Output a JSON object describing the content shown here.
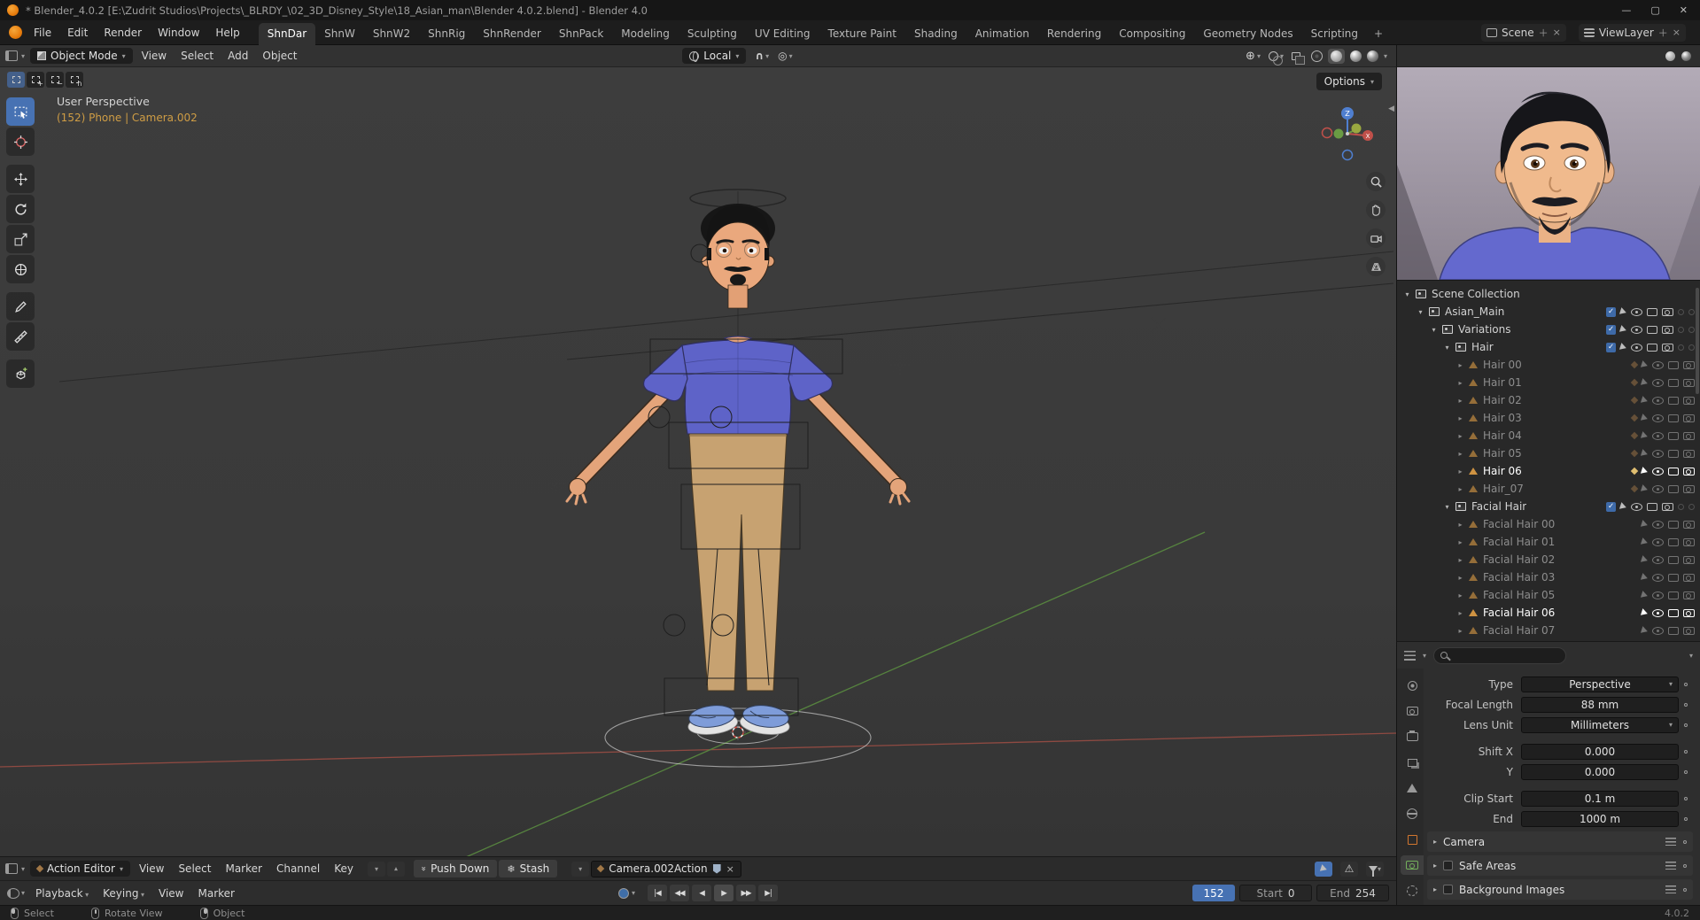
{
  "window": {
    "title": "* Blender_4.0.2 [E:\\Zudrit Studios\\Projects\\_BLRDY_\\02_3D_Disney_Style\\18_Asian_man\\Blender 4.0.2.blend] - Blender 4.0"
  },
  "topbar": {
    "menus": [
      "File",
      "Edit",
      "Render",
      "Window",
      "Help"
    ],
    "workspaces": [
      "ShnDar",
      "ShnW",
      "ShnW2",
      "ShnRig",
      "ShnRender",
      "ShnPack",
      "Modeling",
      "Sculpting",
      "UV Editing",
      "Texture Paint",
      "Shading",
      "Animation",
      "Rendering",
      "Compositing",
      "Geometry Nodes",
      "Scripting"
    ],
    "active_workspace": "ShnDar",
    "add_tab_label": "+",
    "scene_label": "Scene",
    "view_layer_label": "ViewLayer"
  },
  "viewport": {
    "header": {
      "mode_label": "Object Mode",
      "menus": [
        "View",
        "Select",
        "Add",
        "Object"
      ],
      "orientation_label": "Local",
      "select_modes": [
        "set",
        "extend",
        "subtract",
        "intersect"
      ],
      "shading_modes": [
        "wireframe",
        "solid",
        "material-preview",
        "rendered"
      ],
      "active_shading": "solid"
    },
    "overlays": {
      "view_label": "User Perspective",
      "context_label": "(152) Phone | Camera.002",
      "options_label": "Options"
    },
    "nav_gizmo": {
      "z_label": "Z",
      "x_label": "X"
    },
    "nav_icons": [
      "zoom",
      "pan",
      "camera-view",
      "toggle-perspective"
    ],
    "tools": [
      "select-box",
      "cursor",
      "move",
      "rotate",
      "scale",
      "transform",
      "annotate",
      "measure",
      "add-cube"
    ]
  },
  "outliner": {
    "rows": [
      {
        "label": "Scene Collection",
        "indent": 0,
        "kind": "scene",
        "state": "normal"
      },
      {
        "label": "Asian_Main",
        "indent": 1,
        "kind": "collection",
        "state": "normal",
        "check": true
      },
      {
        "label": "Variations",
        "indent": 2,
        "kind": "collection",
        "state": "normal",
        "check": true
      },
      {
        "label": "Hair",
        "indent": 3,
        "kind": "collection",
        "state": "normal",
        "check": true
      },
      {
        "label": "Hair 00",
        "indent": 4,
        "kind": "mesh",
        "state": "dim",
        "anim": true
      },
      {
        "label": "Hair 01",
        "indent": 4,
        "kind": "mesh",
        "state": "dim",
        "anim": true
      },
      {
        "label": "Hair 02",
        "indent": 4,
        "kind": "mesh",
        "state": "dim",
        "anim": true
      },
      {
        "label": "Hair 03",
        "indent": 4,
        "kind": "mesh",
        "state": "dim",
        "anim": true
      },
      {
        "label": "Hair 04",
        "indent": 4,
        "kind": "mesh",
        "state": "dim",
        "anim": true
      },
      {
        "label": "Hair 05",
        "indent": 4,
        "kind": "mesh",
        "state": "dim",
        "anim": true
      },
      {
        "label": "Hair 06",
        "indent": 4,
        "kind": "mesh",
        "state": "selected",
        "anim": true
      },
      {
        "label": "Hair_07",
        "indent": 4,
        "kind": "mesh",
        "state": "dim",
        "anim": true
      },
      {
        "label": "Facial Hair",
        "indent": 3,
        "kind": "collection",
        "state": "normal",
        "check": true
      },
      {
        "label": "Facial Hair 00",
        "indent": 4,
        "kind": "mesh",
        "state": "dim"
      },
      {
        "label": "Facial Hair 01",
        "indent": 4,
        "kind": "mesh",
        "state": "dim"
      },
      {
        "label": "Facial Hair 02",
        "indent": 4,
        "kind": "mesh",
        "state": "dim"
      },
      {
        "label": "Facial Hair 03",
        "indent": 4,
        "kind": "mesh",
        "state": "dim"
      },
      {
        "label": "Facial Hair 05",
        "indent": 4,
        "kind": "mesh",
        "state": "dim"
      },
      {
        "label": "Facial Hair 06",
        "indent": 4,
        "kind": "mesh",
        "state": "selected"
      },
      {
        "label": "Facial Hair 07",
        "indent": 4,
        "kind": "mesh",
        "state": "dim"
      }
    ]
  },
  "properties": {
    "search_value": "",
    "search_placeholder": "",
    "tabs": [
      {
        "name": "tool"
      },
      {
        "name": "render"
      },
      {
        "name": "output"
      },
      {
        "name": "view-layer"
      },
      {
        "name": "scene"
      },
      {
        "name": "world"
      },
      {
        "name": "object"
      },
      {
        "name": "object-data",
        "active": true
      },
      {
        "name": "physics"
      }
    ],
    "fields": [
      {
        "label": "Type",
        "value": "Perspective",
        "kind": "dropdown"
      },
      {
        "label": "Focal Length",
        "value": "88 mm",
        "kind": "number"
      },
      {
        "label": "Lens Unit",
        "value": "Millimeters",
        "kind": "dropdown"
      },
      {
        "label": "Shift X",
        "value": "0.000",
        "kind": "number",
        "gap_before": true
      },
      {
        "label": "Y",
        "value": "0.000",
        "kind": "number"
      },
      {
        "label": "Clip Start",
        "value": "0.1 m",
        "kind": "number",
        "gap_before": true
      },
      {
        "label": "End",
        "value": "1000 m",
        "kind": "number"
      }
    ],
    "sections": [
      {
        "label": "Camera",
        "checkbox": false
      },
      {
        "label": "Safe Areas",
        "checkbox": true
      },
      {
        "label": "Background Images",
        "checkbox": true
      }
    ]
  },
  "dopesheet": {
    "editor_label": "Action Editor",
    "menus": [
      "View",
      "Select",
      "Marker",
      "Channel",
      "Key"
    ],
    "push_down_label": "Push Down",
    "stash_label": "Stash",
    "action_name": "Camera.002Action",
    "right_icons": [
      "only-show-selected",
      "show-errors",
      "filter"
    ]
  },
  "timeline": {
    "menus": [
      {
        "label": "Playback",
        "dropdown": true
      },
      {
        "label": "Keying",
        "dropdown": true
      },
      {
        "label": "View",
        "dropdown": false
      },
      {
        "label": "Marker",
        "dropdown": false
      }
    ],
    "transport": [
      "jump-start",
      "prev-keyframe",
      "play-reverse",
      "play-forward",
      "next-keyframe",
      "jump-end"
    ],
    "current_frame": "152",
    "start_label": "Start",
    "start_value": "0",
    "end_label": "End",
    "end_value": "254"
  },
  "statusbar": {
    "items": [
      {
        "icon": "left-mouse-icon",
        "label": "Select"
      },
      {
        "icon": "middle-mouse-icon",
        "label": "Rotate View"
      },
      {
        "icon": "right-mouse-icon",
        "label": "Object"
      }
    ],
    "version": "4.0.2"
  },
  "colors": {
    "accent": "#4772b3",
    "context_orange": "#cf9d45",
    "shirt": "#5e63c8",
    "pants": "#c7a271",
    "skin": "#eaa87d"
  }
}
